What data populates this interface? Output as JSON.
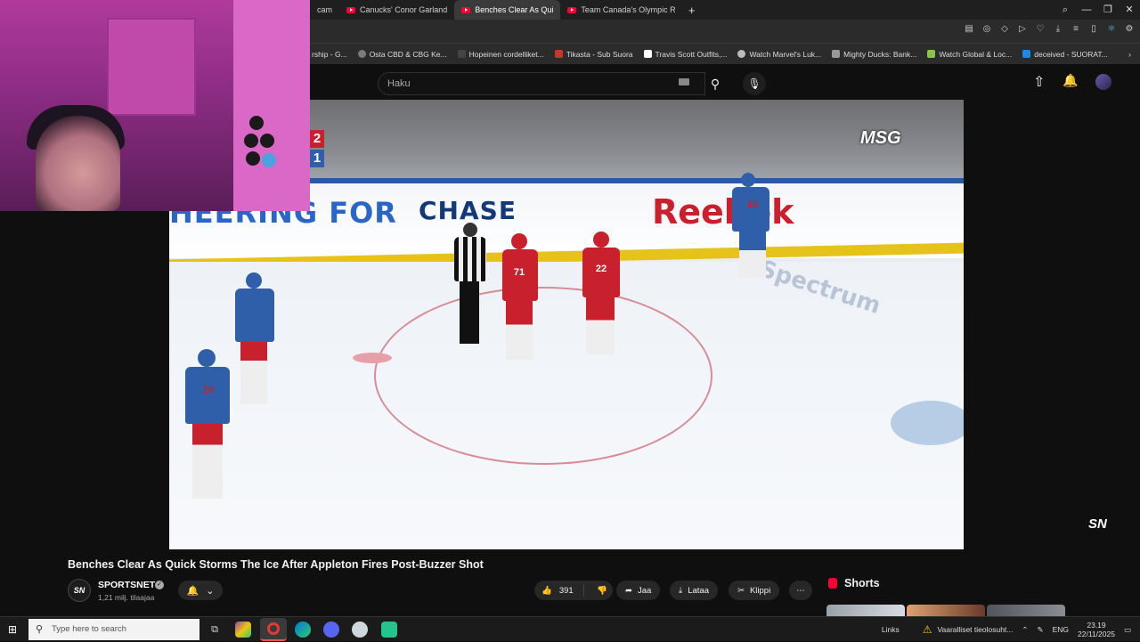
{
  "browser": {
    "tabs": [
      {
        "label": "cam"
      },
      {
        "label": "Canucks' Conor Garland"
      },
      {
        "label": "Benches Clear As Qui"
      },
      {
        "label": "Team Canada's Olympic R"
      }
    ],
    "new_tab": "+",
    "bookmarks": [
      {
        "label": "rship - G...",
        "color": "#3c78d8"
      },
      {
        "label": "Osta CBD & CBG Ke...",
        "color": "#7a7a7a"
      },
      {
        "label": "Hopeinen cordelliket...",
        "color": "#444444"
      },
      {
        "label": "Tikasta - Sub Suora",
        "color": "#c0392b"
      },
      {
        "label": "Travis Scott Outfits,...",
        "color": "#ffffff"
      },
      {
        "label": "Watch Marvel's Luk...",
        "color": "#bbbbbb"
      },
      {
        "label": "Mighty Ducks: Bank...",
        "color": "#999999"
      },
      {
        "label": "Watch Global & Loc...",
        "color": "#8bc34a"
      },
      {
        "label": "deceived - SUORAT...",
        "color": "#1e88e5"
      }
    ]
  },
  "youtube": {
    "search_placeholder": "Haku"
  },
  "video": {
    "score_home": "2",
    "score_away": "1",
    "broadcaster": "MSG",
    "watermark": "SN",
    "ads": {
      "left": "HEERING FOR",
      "center": "CHASE",
      "right": "Reebok",
      "ice": "Spectrum"
    }
  },
  "meta": {
    "title": "Benches Clear As Quick Storms The Ice After Appleton Fires Post-Buzzer Shot",
    "channel_avatar": "SN",
    "channel": "SPORTSNET",
    "subscribers": "1,21 milj. tilaajaa",
    "likes": "391",
    "share": "Jaa",
    "download": "Lataa",
    "clip": "Klippi",
    "shorts": "Shorts"
  },
  "taskbar": {
    "search_placeholder": "Type here to search",
    "links": "Links",
    "warning": "Vaaralliset tieolosuht...",
    "lang": "ENG",
    "time": "23.19",
    "date": "22/11/2025"
  },
  "colors": {
    "accent": "#ff0033",
    "rangers_blue": "#2f5fa8",
    "away_red": "#c8202c"
  }
}
